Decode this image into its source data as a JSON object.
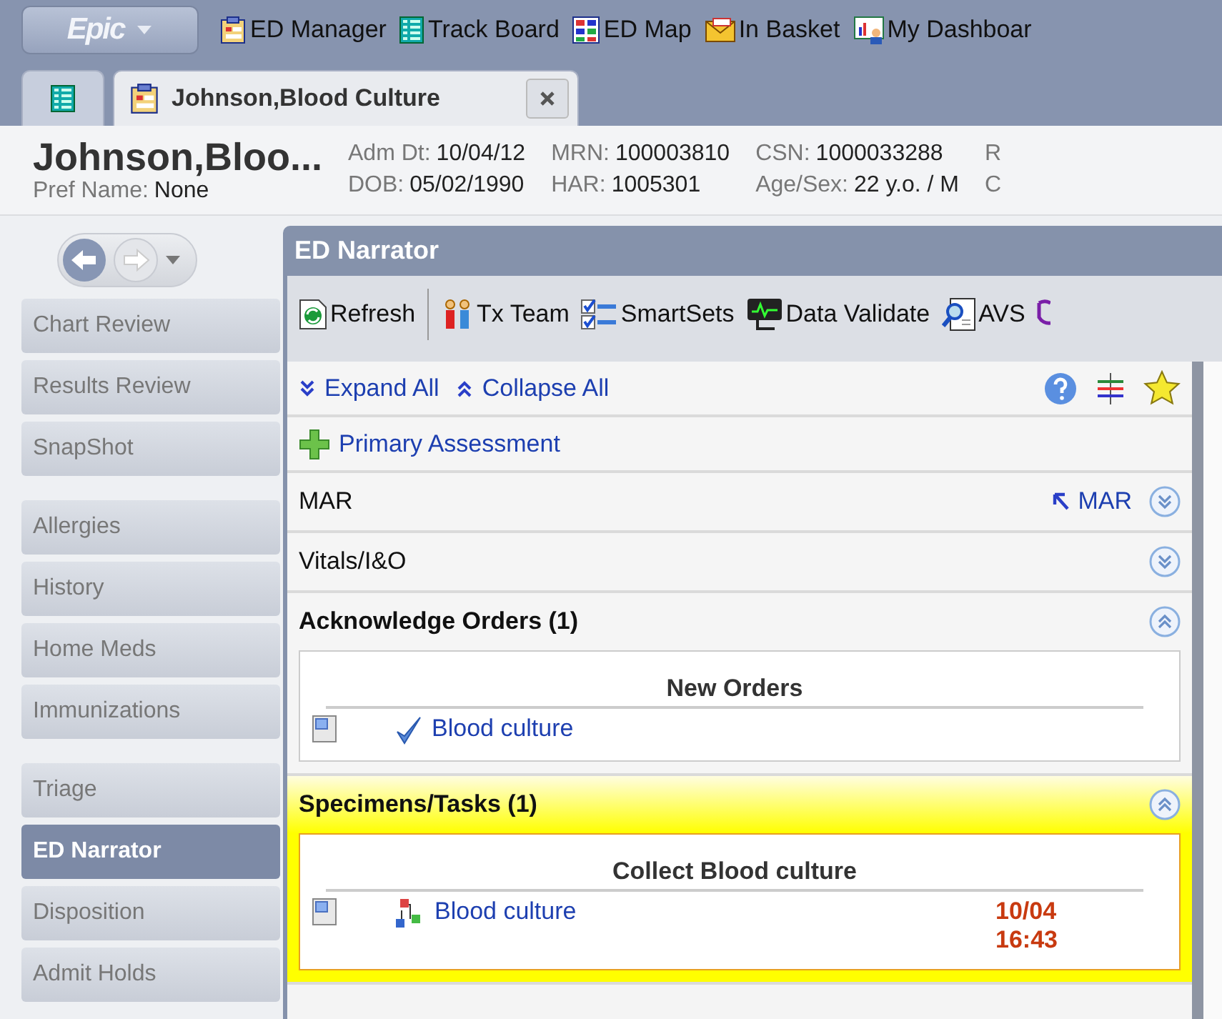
{
  "menu_bar": {
    "app_button": "Epic",
    "items": [
      {
        "label": "ED Manager"
      },
      {
        "label": "Track Board"
      },
      {
        "label": "ED Map"
      },
      {
        "label": "In Basket"
      },
      {
        "label": "My Dashboar"
      }
    ]
  },
  "tabs": [
    {
      "selected": false
    },
    {
      "label": "Johnson,Blood Culture",
      "selected": true
    }
  ],
  "patient": {
    "name": "Johnson,Bloo...",
    "pref_label": "Pref Name:",
    "pref_value": "None",
    "columns": [
      [
        {
          "label": "Adm Dt:",
          "value": "10/04/12"
        },
        {
          "label": "DOB:",
          "value": "05/02/1990"
        }
      ],
      [
        {
          "label": "MRN:",
          "value": "100003810"
        },
        {
          "label": "HAR:",
          "value": "1005301"
        }
      ],
      [
        {
          "label": "CSN:",
          "value": "1000033288"
        },
        {
          "label": "Age/Sex:",
          "value": "22 y.o. / M"
        }
      ],
      [
        {
          "label": "R"
        },
        {
          "label": "C"
        }
      ]
    ]
  },
  "sidebar": {
    "groups": [
      [
        {
          "label": "Chart Review",
          "selected": false
        },
        {
          "label": "Results Review",
          "selected": false
        },
        {
          "label": "SnapShot",
          "selected": false
        }
      ],
      [
        {
          "label": "Allergies",
          "selected": false
        },
        {
          "label": "History",
          "selected": false
        },
        {
          "label": "Home Meds",
          "selected": false
        },
        {
          "label": "Immunizations",
          "selected": false
        }
      ],
      [
        {
          "label": "Triage",
          "selected": false
        },
        {
          "label": "ED Narrator",
          "selected": true
        },
        {
          "label": "Disposition",
          "selected": false
        },
        {
          "label": "Admit Holds",
          "selected": false
        }
      ]
    ]
  },
  "narrator": {
    "title": "ED Narrator",
    "toolbar": [
      {
        "label": "Refresh"
      },
      {
        "label": "Tx Team"
      },
      {
        "label": "SmartSets"
      },
      {
        "label": "Data Validate"
      },
      {
        "label": "AVS"
      }
    ],
    "expand_all": "Expand All",
    "collapse_all": "Collapse All",
    "sections": [
      {
        "kind": "action",
        "label": "Primary Assessment"
      },
      {
        "kind": "section",
        "title": "MAR",
        "link": "MAR",
        "expanded": false,
        "highlighted": false
      },
      {
        "kind": "section",
        "title": "Vitals/I&O",
        "expanded": false,
        "highlighted": false
      },
      {
        "kind": "section",
        "title": "Acknowledge Orders (1)",
        "expanded": true,
        "highlighted": false,
        "card": {
          "heading": "New Orders",
          "rows": [
            {
              "kind": "order",
              "label": "Blood culture"
            }
          ]
        }
      },
      {
        "kind": "section",
        "title": "Specimens/Tasks (1)",
        "expanded": true,
        "highlighted": true,
        "card": {
          "heading": "Collect Blood culture",
          "rows": [
            {
              "kind": "task",
              "label": "Blood culture",
              "date": "10/04",
              "time": "16:43"
            }
          ]
        }
      }
    ]
  }
}
